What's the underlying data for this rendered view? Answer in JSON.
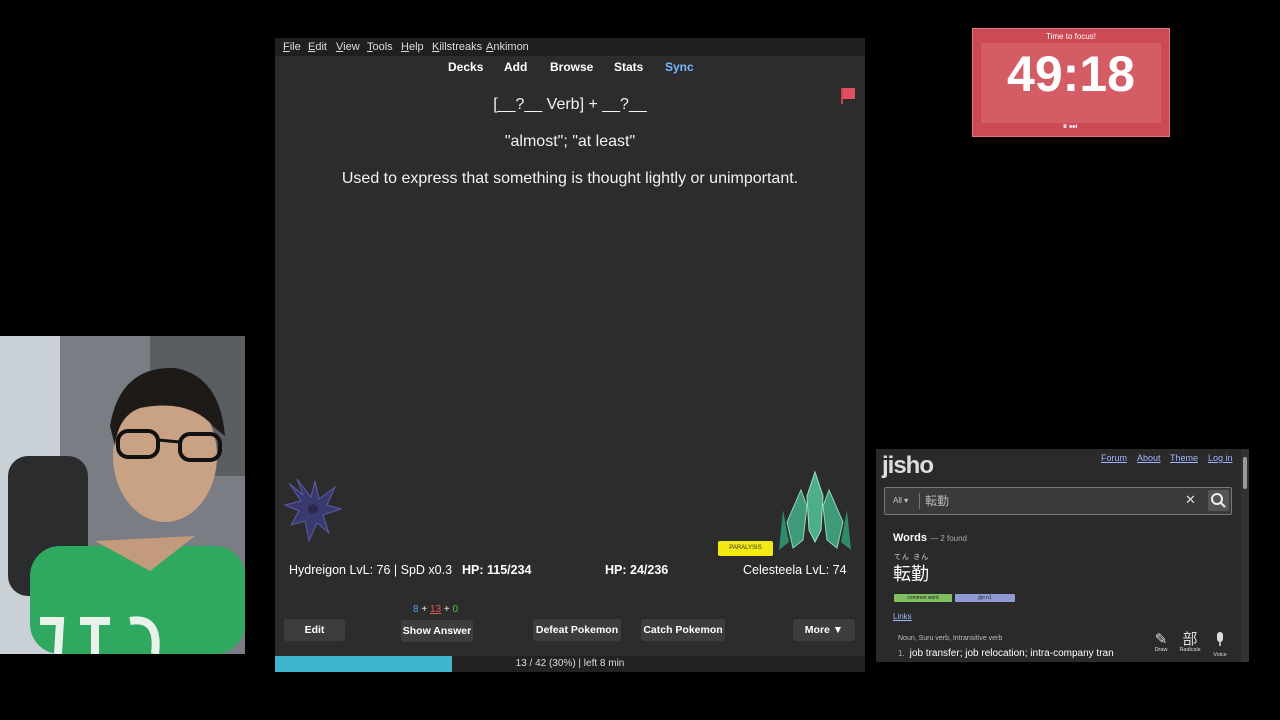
{
  "anki": {
    "menu": [
      "File",
      "Edit",
      "View",
      "Tools",
      "Help",
      "Killstreaks",
      "Ankimon"
    ],
    "toolbar": [
      "Decks",
      "Add",
      "Browse",
      "Stats",
      "Sync"
    ],
    "card": {
      "pattern": "[__?__ Verb] + __?__",
      "meaning": "\"almost\"; \"at least\"",
      "explanation": "Used to express that something is thought lightly or unimportant."
    },
    "battle": {
      "player_name_level": "Hydreigon LvL: 76 | SpD x0.3",
      "player_hp": "HP: 115/234",
      "enemy_hp": "HP: 24/236",
      "enemy_name_level": "Celesteela LvL: 74",
      "status_badge": "PARALYSIS"
    },
    "counts": {
      "new": "8",
      "plus1": "+",
      "learn": "13",
      "plus2": "+",
      "review": "0"
    },
    "buttons": {
      "edit": "Edit",
      "show_answer": "Show Answer",
      "defeat": "Defeat Pokemon",
      "catch": "Catch Pokemon",
      "more": "More ▼"
    },
    "progress": {
      "fraction": 0.3,
      "text": "13 / 42 (30%) | left 8 min"
    },
    "colors": {
      "progress": "#3fb5d0",
      "flag": "#e0505e",
      "sync": "#79b8ff"
    }
  },
  "timer": {
    "label": "Time to focus!",
    "time": "49:18",
    "controls": "⏸⏭"
  },
  "jisho": {
    "logo": "jisho",
    "nav": [
      "Forum",
      "About",
      "Theme",
      "Log in"
    ],
    "search": {
      "scope": "All ▾",
      "value": "転勤"
    },
    "words_heading": "Words",
    "words_count": "— 2 found",
    "furigana": "てん きん",
    "word": "転勤",
    "tags": [
      "common word",
      "jlpt n1"
    ],
    "links": "Links",
    "pos": "Noun, Suru verb, Intransitive verb",
    "def_num": "1.",
    "definition": "job transfer; job relocation; intra-company tran",
    "tools": [
      {
        "icon": "✎",
        "label": "Draw"
      },
      {
        "icon": "部",
        "label": "Radicals"
      },
      {
        "icon": "●",
        "label": "Voice"
      }
    ]
  }
}
